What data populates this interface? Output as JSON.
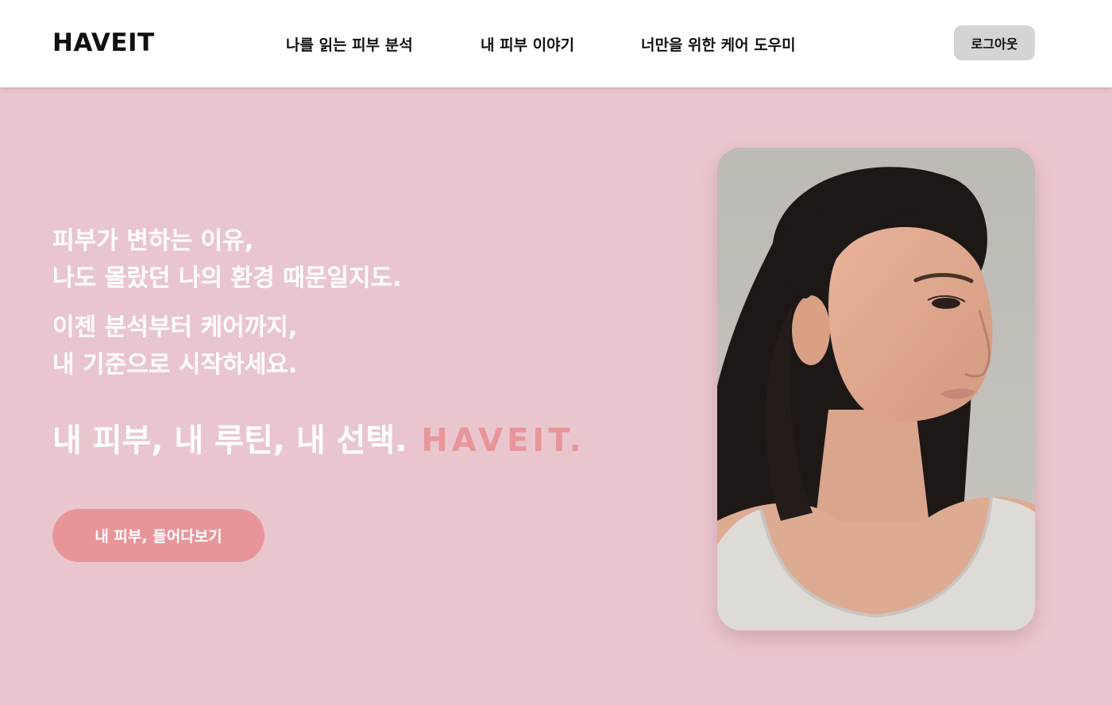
{
  "header": {
    "logo": "HAVEIT",
    "nav": [
      {
        "label": "나를 읽는 피부 분석"
      },
      {
        "label": "내 피부 이야기"
      },
      {
        "label": "너만을 위한 케어 도우미"
      }
    ],
    "logout_label": "로그아웃"
  },
  "hero": {
    "line1": "피부가 변하는 이유,",
    "line2": "나도 몰랐던 나의 환경 때문일지도.",
    "line3": "이젠 분석부터 케어까지,",
    "line4": "내 기준으로 시작하세요.",
    "tagline": "내 피부, 내 루틴, 내 선택.",
    "tagline_brand": "HAVEIT.",
    "cta_label": "내 피부, 들어다보기"
  },
  "colors": {
    "background": "#e9c6cd",
    "accent": "#e8959a",
    "header_bg": "#ffffff",
    "logout_bg": "#d4d4d4"
  },
  "image": {
    "semantic": "portrait-photo-woman-profile"
  }
}
